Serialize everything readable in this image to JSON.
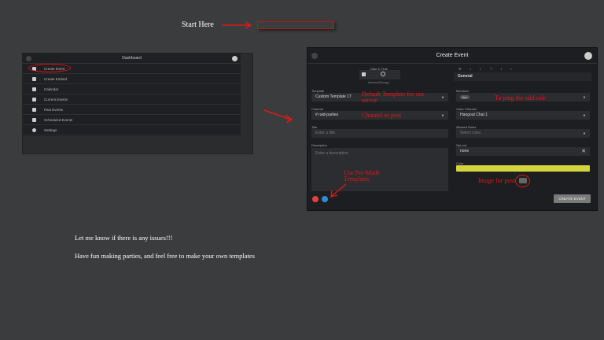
{
  "instructions": {
    "start_here": "Start Here",
    "msg1": "Let me know if there is any issues!!!",
    "msg2": "Have fun making parties, and feel free to make your own templates"
  },
  "dashboard": {
    "title": "Dashboard",
    "items": [
      {
        "label": "Create Event",
        "icon": "calendar-plus-icon"
      },
      {
        "label": "Create Embed",
        "icon": "embed-icon"
      },
      {
        "label": "Calendar",
        "icon": "calendar-icon"
      },
      {
        "label": "Current Events",
        "icon": "list-icon"
      },
      {
        "label": "Past Events",
        "icon": "history-icon"
      },
      {
        "label": "Scheduled Events",
        "icon": "clock-icon"
      },
      {
        "label": "Settings",
        "icon": "gear-icon"
      }
    ]
  },
  "create_event": {
    "title": "Create Event",
    "date_time_label": "Date & Time",
    "timezone": "America/Chicago",
    "template_label": "Template",
    "template_value": "Custom Template 17",
    "channel_label": "Channel",
    "channel_value": "# raid-parties",
    "title_label": "Title",
    "title_placeholder": "Enter a title",
    "description_label": "Description",
    "description_placeholder": "Enter a description",
    "general_label": "General",
    "mentions_label": "Mentions",
    "mention_chip": "fun",
    "voice_label": "Voice Channel",
    "voice_value": "Hangout Chat 1",
    "roles_label": "Allowed Roles",
    "roles_placeholder": "Select roles",
    "optout_label": "Opt-out",
    "optout_value": "none",
    "color_label": "Color",
    "color_value": "#d4d43c",
    "create_button": "CREATE EVENT"
  },
  "annotations": {
    "template": "Default Template for our server",
    "channel": "Channel to post",
    "mentions": "To ping the raid role",
    "image": "Image for post",
    "premade": "Use Pre-Made Templates"
  },
  "colors": {
    "annotation": "#e01818",
    "accent_blue": "#2a8be0",
    "danger": "#e04040"
  }
}
